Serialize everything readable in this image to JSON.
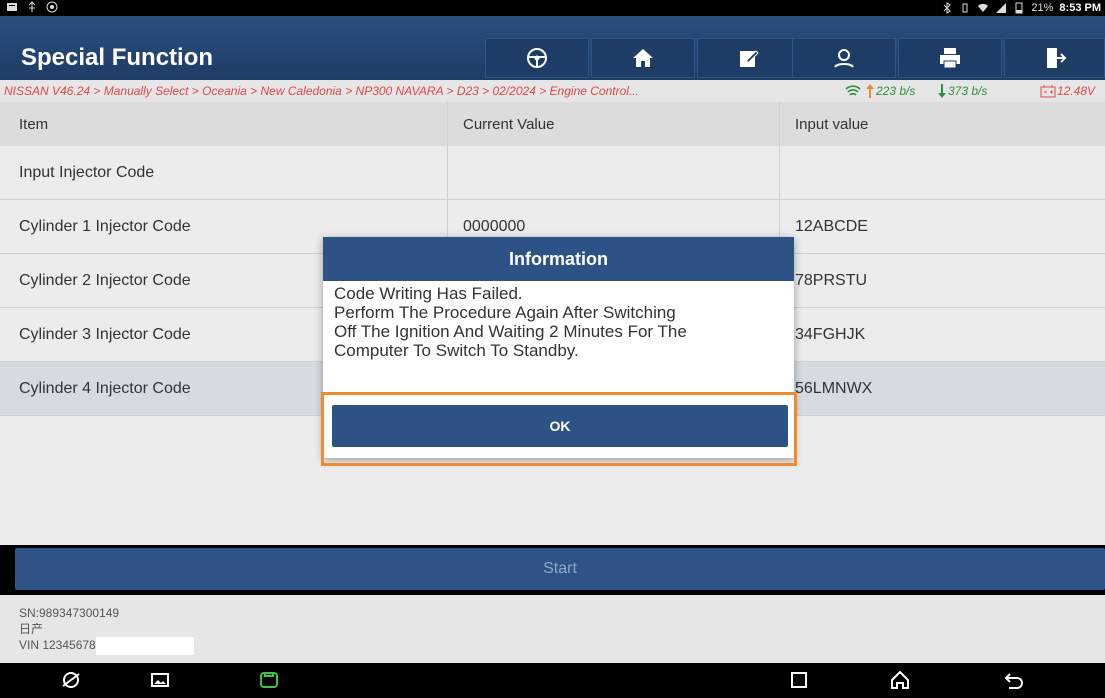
{
  "statusbar": {
    "battery": "21%",
    "time": "8:53 PM"
  },
  "header": {
    "title": "Special Function",
    "buttons": [
      "steering-wheel-icon",
      "home-icon",
      "edit-icon",
      "user-icon",
      "printer-icon",
      "exit-icon"
    ]
  },
  "breadcrumb": {
    "path": "NISSAN V46.24 > Manually Select > Oceania > New Caledonia > NP300 NAVARA > D23 > 02/2024 > Engine Control...",
    "upload": "223 b/s",
    "download": "373 b/s",
    "voltage": "12.48V"
  },
  "table": {
    "headers": [
      "Item",
      "Current Value",
      "Input value"
    ],
    "rows": [
      {
        "item": "Input Injector Code",
        "current": "",
        "input": ""
      },
      {
        "item": "Cylinder 1 Injector Code",
        "current": "0000000",
        "input": "12ABCDE"
      },
      {
        "item": "Cylinder 2 Injector Code",
        "current": "",
        "input": "78PRSTU"
      },
      {
        "item": "Cylinder 3 Injector Code",
        "current": "",
        "input": "34FGHJK"
      },
      {
        "item": "Cylinder 4 Injector Code",
        "current": "",
        "input": "56LMNWX"
      }
    ]
  },
  "start_label": "Start",
  "footer": {
    "sn": "SN:989347300149",
    "brand": "日产",
    "vin": "VIN 123456789"
  },
  "dialog": {
    "title": "Information",
    "message_lines": [
      "Code Writing Has Failed.",
      "Perform The Procedure Again After Switching",
      "Off The Ignition And Waiting 2 Minutes For The",
      "Computer To Switch To Standby."
    ],
    "ok_label": "OK"
  },
  "colors": {
    "header": "#2b4f7e",
    "highlight": "#f08a2c",
    "crumb": "#e04747",
    "rate": "#2e8f3c"
  }
}
